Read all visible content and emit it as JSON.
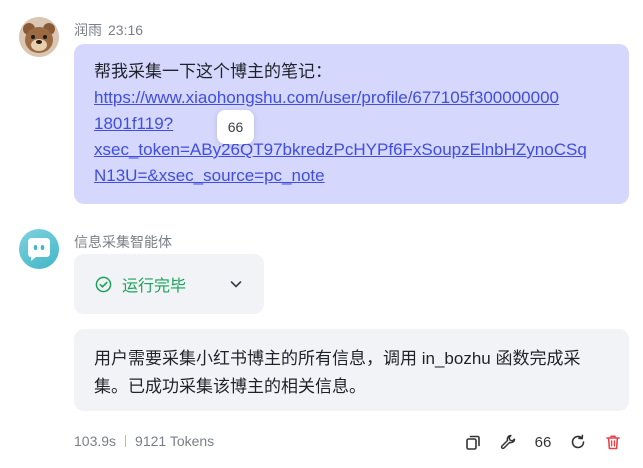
{
  "user_message": {
    "sender": "润雨",
    "time": "23:16",
    "intro": "帮我采集一下这个博主的笔记：",
    "link_lines": [
      "https://www.xiaohongshu.com/user/profile/677105f300000000",
      "1801f119?",
      "xsec_token=ABy26QT97bkredzPcHYPf6FxSoupzElnbHZynoCSq",
      "N13U=&xsec_source=pc_note"
    ]
  },
  "hover_badge": "66",
  "bot_message": {
    "name": "信息采集智能体",
    "status": "运行完毕",
    "answer_lines": [
      "用户需要采集小红书博主的所有信息，调用 in_bozhu 函数完成采",
      "集。已成功采集该博主的相关信息。"
    ],
    "duration": "103.9s",
    "tokens": "9121 Tokens",
    "action_count": "66"
  },
  "colors": {
    "user_bubble": "#d5d7fd",
    "link": "#3f4ee0",
    "status_green": "#1aa35a",
    "delete_red": "#e8414a",
    "card_bg": "#f2f3f7"
  },
  "icons": [
    "bear-avatar",
    "robot-avatar",
    "check-circle-icon",
    "chevron-down-icon",
    "copy-icon",
    "wrench-icon",
    "refresh-icon",
    "trash-icon"
  ]
}
